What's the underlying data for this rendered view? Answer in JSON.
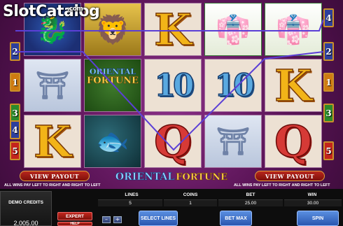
{
  "watermark": {
    "text": "SlotCatalog",
    "suffix": ".com"
  },
  "paylines": {
    "left": [
      "2",
      "1",
      "3",
      "4",
      "5"
    ],
    "right": [
      "4",
      "2",
      "1",
      "3",
      "5"
    ],
    "left_top_partial": "",
    "colors": {
      "1": "#cf7b11",
      "2": "#2d3f9c",
      "3": "#2b8a2b",
      "4": "#2d3f9c",
      "5": "#c4241c"
    }
  },
  "reels": [
    [
      {
        "symbol": "dragon",
        "icon": "dragon-icon"
      },
      {
        "symbol": "temple",
        "icon": "pagoda-icon"
      },
      {
        "symbol": "K",
        "label": "K"
      }
    ],
    [
      {
        "symbol": "lion",
        "icon": "foo-dog-icon"
      },
      {
        "symbol": "logo",
        "line1": "ORIENTAL",
        "line2": "FORTUNE"
      },
      {
        "symbol": "koi",
        "icon": "koi-fish-icon"
      }
    ],
    [
      {
        "symbol": "K",
        "label": "K"
      },
      {
        "symbol": "10",
        "label": "10"
      },
      {
        "symbol": "Q",
        "label": "Q"
      }
    ],
    [
      {
        "symbol": "geisha",
        "icon": "geisha-icon"
      },
      {
        "symbol": "10",
        "label": "10"
      },
      {
        "symbol": "temple",
        "icon": "pagoda-icon"
      }
    ],
    [
      {
        "symbol": "geisha",
        "icon": "geisha-icon"
      },
      {
        "symbol": "K",
        "label": "K"
      },
      {
        "symbol": "Q",
        "label": "Q"
      }
    ]
  ],
  "winning_line_color": "#5b3fd6",
  "view_payout_left": "VIEW PAYOUT",
  "view_payout_right": "VIEW PAYOUT",
  "logo": {
    "part1": "ORIENTAL",
    "part2": "FORTUNE"
  },
  "wins_note_left": "ALL WINS PAY LEFT TO RIGHT AND RIGHT TO LEFT",
  "wins_note_right": "ALL WINS PAY LEFT TO RIGHT AND RIGHT TO LEFT",
  "panel": {
    "credits_label": "DEMO CREDITS",
    "credits_value": "2,005.00",
    "expert_label": "EXPERT",
    "help_label": "HELP",
    "minus_label": "–",
    "plus_label": "+",
    "stats": [
      {
        "label": "LINES",
        "value": "5"
      },
      {
        "label": "COINS",
        "value": "1"
      },
      {
        "label": "BET",
        "value": "25.00"
      },
      {
        "label": "WIN",
        "value": "30.00"
      }
    ],
    "select_lines_label": "SELECT LINES",
    "bet_max_label": "BET MAX",
    "spin_label": "SPIN"
  }
}
